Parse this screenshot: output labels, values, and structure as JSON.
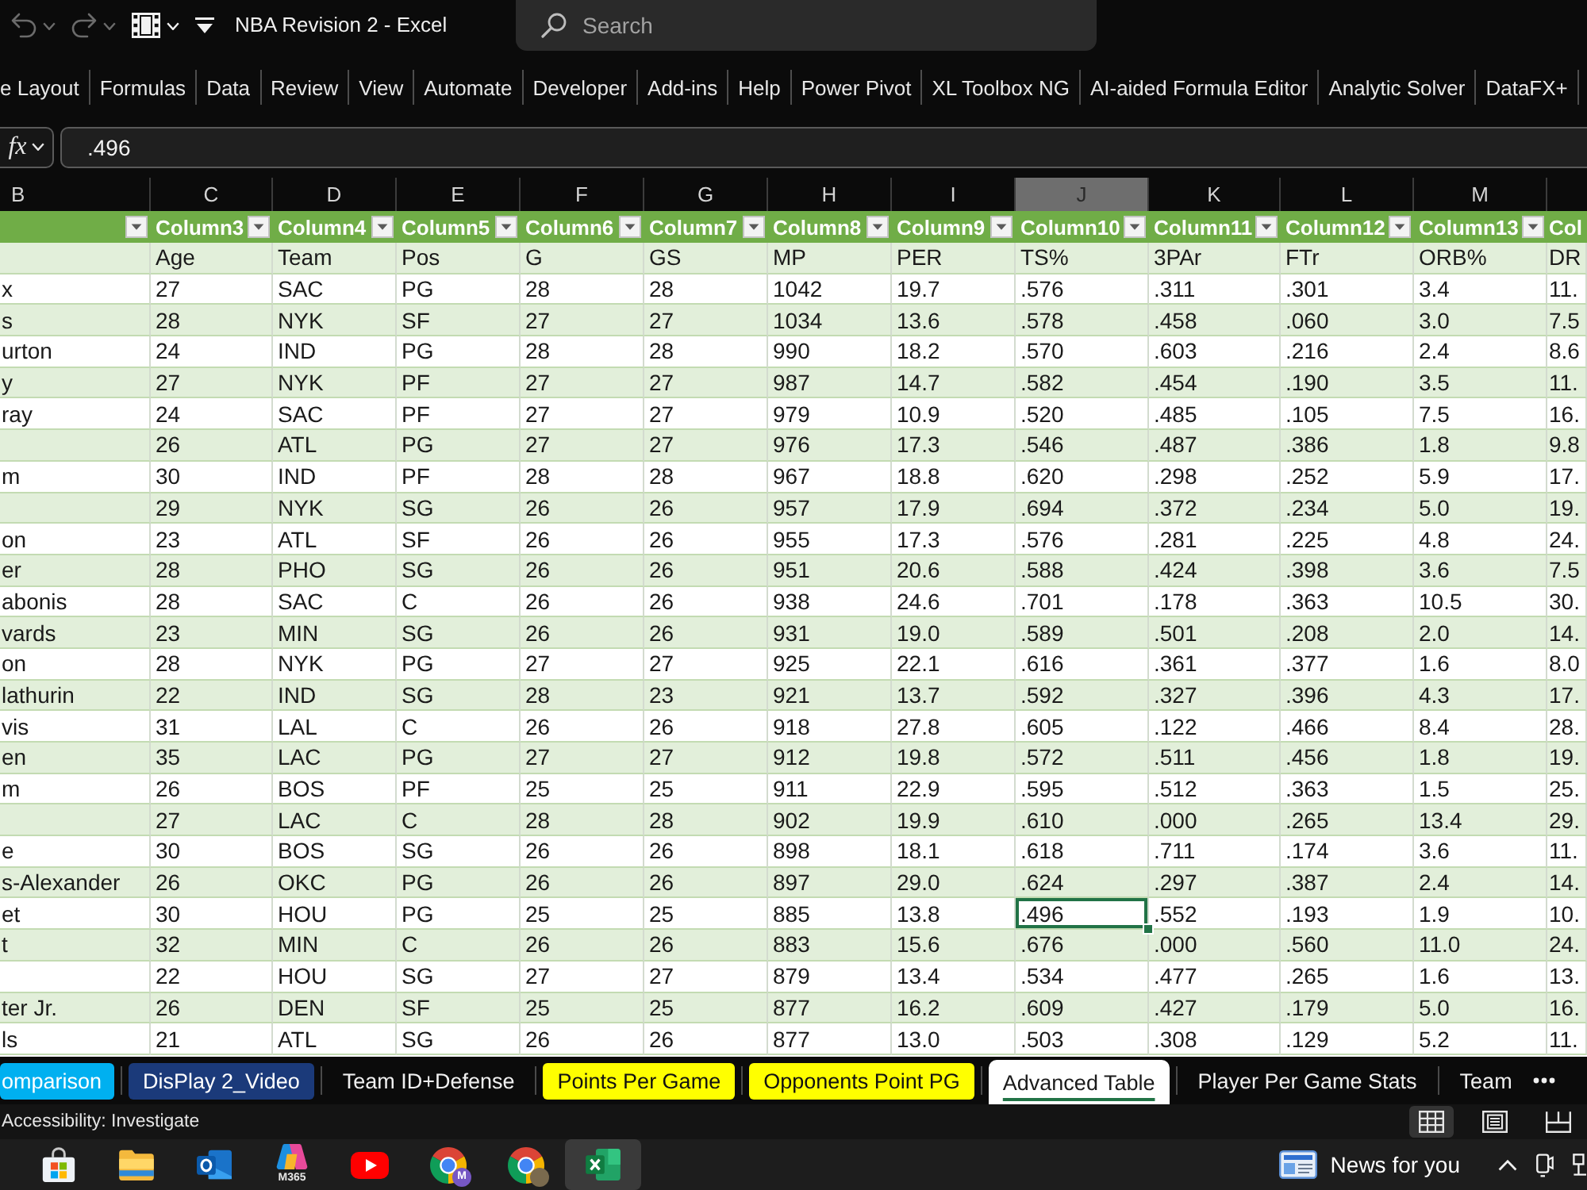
{
  "title_bar": {
    "quick_access": [
      {
        "kind": "undo",
        "disabled": true
      },
      {
        "kind": "redo",
        "disabled": true
      },
      {
        "kind": "video",
        "disabled": false
      },
      {
        "kind": "customize",
        "disabled": false
      }
    ],
    "title": "NBA Revision 2 - Excel",
    "search": {
      "placeholder": "Search"
    }
  },
  "ribbon": {
    "tabs": [
      {
        "label": "e Layout",
        "selected": false
      },
      {
        "label": "Formulas",
        "selected": false
      },
      {
        "label": "Data",
        "selected": false
      },
      {
        "label": "Review",
        "selected": false
      },
      {
        "label": "View",
        "selected": false
      },
      {
        "label": "Automate",
        "selected": false
      },
      {
        "label": "Developer",
        "selected": false
      },
      {
        "label": "Add-ins",
        "selected": false
      },
      {
        "label": "Help",
        "selected": false
      },
      {
        "label": "Power Pivot",
        "selected": false
      },
      {
        "label": "XL Toolbox NG",
        "selected": false
      },
      {
        "label": "AI-aided Formula Editor",
        "selected": false
      },
      {
        "label": "Analytic Solver",
        "selected": false
      },
      {
        "label": "DataFX+",
        "selected": false
      }
    ]
  },
  "formula_bar": {
    "fx_label": "fx",
    "value": ".496"
  },
  "sheet": {
    "autofilter": true,
    "columns": [
      {
        "letter": "B",
        "selected": false
      },
      {
        "letter": "C",
        "header": "Column3",
        "selected": false
      },
      {
        "letter": "D",
        "header": "Column4",
        "selected": false
      },
      {
        "letter": "E",
        "header": "Column5",
        "selected": false
      },
      {
        "letter": "F",
        "header": "Column6",
        "selected": false
      },
      {
        "letter": "G",
        "header": "Column7",
        "selected": false
      },
      {
        "letter": "H",
        "header": "Column8",
        "selected": false
      },
      {
        "letter": "I",
        "header": "Column9",
        "selected": false
      },
      {
        "letter": "J",
        "header": "Column10",
        "selected": true
      },
      {
        "letter": "K",
        "header": "Column11",
        "selected": false
      },
      {
        "letter": "L",
        "header": "Column12",
        "selected": false
      },
      {
        "letter": "M",
        "header": "Column13",
        "selected": false
      },
      {
        "header": "Col"
      }
    ],
    "rows": [
      {
        "values": [
          "Age",
          "Team",
          "Pos",
          "G",
          "GS",
          "MP",
          "PER",
          "TS%",
          "3PAr",
          "FTr",
          "ORB%",
          "DR"
        ],
        "selected": false
      },
      {
        "name": "x",
        "values": [
          "27",
          "SAC",
          "PG",
          "28",
          "28",
          "1042",
          "19.7",
          ".576",
          ".311",
          ".301",
          "3.4",
          "11."
        ],
        "selected": false
      },
      {
        "name": "s",
        "values": [
          "28",
          "NYK",
          "SF",
          "27",
          "27",
          "1034",
          "13.6",
          ".578",
          ".458",
          ".060",
          "3.0",
          "7.5"
        ],
        "selected": false
      },
      {
        "name": "urton",
        "values": [
          "24",
          "IND",
          "PG",
          "28",
          "28",
          "990",
          "18.2",
          ".570",
          ".603",
          ".216",
          "2.4",
          "8.6"
        ],
        "selected": false
      },
      {
        "name": "y",
        "values": [
          "27",
          "NYK",
          "PF",
          "27",
          "27",
          "987",
          "14.7",
          ".582",
          ".454",
          ".190",
          "3.5",
          "11."
        ],
        "selected": false
      },
      {
        "name": "ray",
        "values": [
          "24",
          "SAC",
          "PF",
          "27",
          "27",
          "979",
          "10.9",
          ".520",
          ".485",
          ".105",
          "7.5",
          "16."
        ],
        "selected": false
      },
      {
        "values": [
          "26",
          "ATL",
          "PG",
          "27",
          "27",
          "976",
          "17.3",
          ".546",
          ".487",
          ".386",
          "1.8",
          "9.8"
        ],
        "selected": false
      },
      {
        "name": "m",
        "values": [
          "30",
          "IND",
          "PF",
          "28",
          "28",
          "967",
          "18.8",
          ".620",
          ".298",
          ".252",
          "5.9",
          "17."
        ],
        "selected": false
      },
      {
        "values": [
          "29",
          "NYK",
          "SG",
          "26",
          "26",
          "957",
          "17.9",
          ".694",
          ".372",
          ".234",
          "5.0",
          "19."
        ],
        "selected": false
      },
      {
        "name": "on",
        "values": [
          "23",
          "ATL",
          "SF",
          "26",
          "26",
          "955",
          "17.3",
          ".576",
          ".281",
          ".225",
          "4.8",
          "24."
        ],
        "selected": false
      },
      {
        "name": "er",
        "values": [
          "28",
          "PHO",
          "SG",
          "26",
          "26",
          "951",
          "20.6",
          ".588",
          ".424",
          ".398",
          "3.6",
          "7.5"
        ],
        "selected": false
      },
      {
        "name": "abonis",
        "values": [
          "28",
          "SAC",
          "C",
          "26",
          "26",
          "938",
          "24.6",
          ".701",
          ".178",
          ".363",
          "10.5",
          "30."
        ],
        "selected": false
      },
      {
        "name": "vards",
        "values": [
          "23",
          "MIN",
          "SG",
          "26",
          "26",
          "931",
          "19.0",
          ".589",
          ".501",
          ".208",
          "2.0",
          "14."
        ],
        "selected": false
      },
      {
        "name": "on",
        "values": [
          "28",
          "NYK",
          "PG",
          "27",
          "27",
          "925",
          "22.1",
          ".616",
          ".361",
          ".377",
          "1.6",
          "8.0"
        ],
        "selected": false
      },
      {
        "name": "lathurin",
        "values": [
          "22",
          "IND",
          "SG",
          "28",
          "23",
          "921",
          "13.7",
          ".592",
          ".327",
          ".396",
          "4.3",
          "17."
        ],
        "selected": false
      },
      {
        "name": "vis",
        "values": [
          "31",
          "LAL",
          "C",
          "26",
          "26",
          "918",
          "27.8",
          ".605",
          ".122",
          ".466",
          "8.4",
          "28."
        ],
        "selected": false
      },
      {
        "name": "en",
        "values": [
          "35",
          "LAC",
          "PG",
          "27",
          "27",
          "912",
          "19.8",
          ".572",
          ".511",
          ".456",
          "1.8",
          "19."
        ],
        "selected": false
      },
      {
        "name": "m",
        "values": [
          "26",
          "BOS",
          "PF",
          "25",
          "25",
          "911",
          "22.9",
          ".595",
          ".512",
          ".363",
          "1.5",
          "25."
        ],
        "selected": false
      },
      {
        "values": [
          "27",
          "LAC",
          "C",
          "28",
          "28",
          "902",
          "19.9",
          ".610",
          ".000",
          ".265",
          "13.4",
          "29."
        ],
        "selected": false
      },
      {
        "name": "e",
        "values": [
          "30",
          "BOS",
          "SG",
          "26",
          "26",
          "898",
          "18.1",
          ".618",
          ".711",
          ".174",
          "3.6",
          "11."
        ],
        "selected": false
      },
      {
        "name": "s-Alexander",
        "values": [
          "26",
          "OKC",
          "PG",
          "26",
          "26",
          "897",
          "29.0",
          ".624",
          ".297",
          ".387",
          "2.4",
          "14."
        ],
        "selected": false
      },
      {
        "name": "et",
        "values": [
          "30",
          "HOU",
          "PG",
          "25",
          "25",
          "885",
          "13.8",
          ".496",
          ".552",
          ".193",
          "1.9",
          "10."
        ],
        "selected": true
      },
      {
        "name": "t",
        "values": [
          "32",
          "MIN",
          "C",
          "26",
          "26",
          "883",
          "15.6",
          ".676",
          ".000",
          ".560",
          "11.0",
          "24."
        ],
        "selected": false
      },
      {
        "values": [
          "22",
          "HOU",
          "SG",
          "27",
          "27",
          "879",
          "13.4",
          ".534",
          ".477",
          ".265",
          "1.6",
          "13."
        ],
        "selected": false
      },
      {
        "name": "ter Jr.",
        "values": [
          "26",
          "DEN",
          "SF",
          "25",
          "25",
          "877",
          "16.2",
          ".609",
          ".427",
          ".179",
          "5.0",
          "16."
        ],
        "selected": false
      },
      {
        "name": "ls",
        "values": [
          "21",
          "ATL",
          "SG",
          "26",
          "26",
          "877",
          "13.0",
          ".503",
          ".308",
          ".129",
          "5.2",
          "11."
        ],
        "selected": false
      }
    ]
  },
  "sheet_tabs": [
    {
      "label": "omparison",
      "color": "#00b0f0",
      "selected": false
    },
    {
      "label": "DisPlay 2_Video",
      "color": "#1b3a7a",
      "selected": false
    },
    {
      "label": "Team ID+Defense",
      "selected": false
    },
    {
      "label": "Points Per Game",
      "color": "#ffff00",
      "selected": false
    },
    {
      "label": "Opponents Point PG",
      "color": "#ffff00",
      "selected": false
    },
    {
      "label": "Advanced Table",
      "selected": true
    },
    {
      "label": "Player Per Game Stats",
      "selected": false
    },
    {
      "label": "Team",
      "selected": false
    }
  ],
  "status_bar": {
    "text": "Accessibility: Investigate",
    "views": [
      {
        "kind": "normal",
        "selected": true
      },
      {
        "kind": "page_layout",
        "selected": false
      },
      {
        "kind": "page_break",
        "selected": false
      }
    ]
  },
  "taskbar": {
    "apps": [
      {
        "kind": "store",
        "active": false
      },
      {
        "kind": "folder",
        "active": false
      },
      {
        "kind": "mail",
        "active": false
      },
      {
        "kind": "copilot",
        "caption": "M365",
        "active": false
      },
      {
        "kind": "video",
        "active": false
      },
      {
        "kind": "browser_profile",
        "badge": "M",
        "active": false
      },
      {
        "kind": "browser_avatar",
        "active": false
      },
      {
        "kind": "spreadsheet",
        "active": true
      }
    ],
    "news": "News for you"
  }
}
